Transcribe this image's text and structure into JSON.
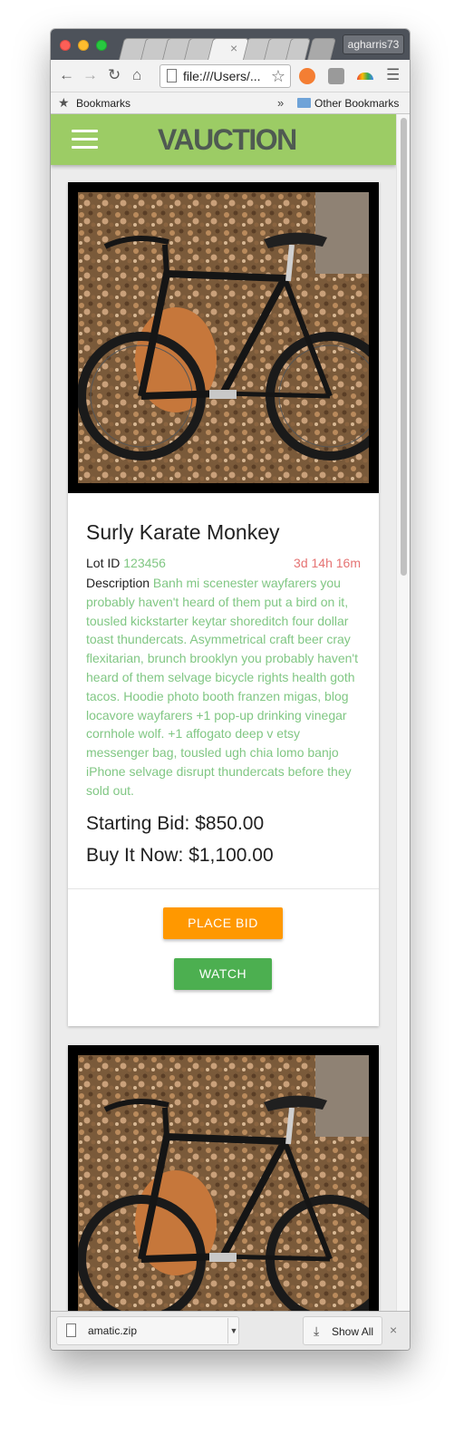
{
  "browser": {
    "profile_name": "agharris73",
    "url": "file:///Users/...",
    "bookmarks_label": "Bookmarks",
    "bookmarks_overflow": "»",
    "other_bookmarks_label": "Other Bookmarks",
    "tab_close_glyph": "×"
  },
  "app": {
    "brand": "VAUCTION",
    "accent_color": "#9ccc65"
  },
  "listings": [
    {
      "title": "Surly Karate Monkey",
      "lot_id_label": "Lot ID",
      "lot_id": "123456",
      "time_left": "3d 14h 16m",
      "description_label": "Description",
      "description": "Banh mi scenester wayfarers you probably haven't heard of them put a bird on it, tousled kickstarter keytar shoreditch four dollar toast thundercats. Asymmetrical craft beer cray flexitarian, brunch brooklyn you probably haven't heard of them selvage bicycle rights health goth tacos. Hoodie photo booth franzen migas, blog locavore wayfarers +1 pop-up drinking vinegar cornhole wolf. +1 affogato deep v etsy messenger bag, tousled ugh chia lomo banjo iPhone selvage disrupt thundercats before they sold out.",
      "starting_bid": "Starting Bid: $850.00",
      "buy_it_now": "Buy It Now: $1,100.00",
      "place_bid_label": "PLACE BID",
      "watch_label": "WATCH"
    }
  ],
  "downloads": {
    "file_name": "amatic.zip",
    "show_all_label": "Show All",
    "close_glyph": "×"
  },
  "colors": {
    "place_bid": "#ff9800",
    "watch": "#4caf50",
    "time_left": "#e57373",
    "lot_value": "#81c784"
  }
}
